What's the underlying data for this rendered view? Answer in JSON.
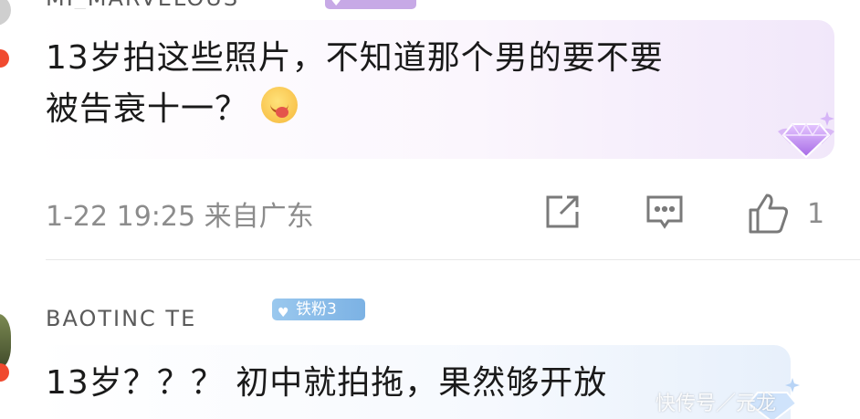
{
  "comments": [
    {
      "username": "MI_MARVELOUS",
      "fan_badge": "",
      "text_line1": "13岁拍这些照片，不知道那个男的要不要",
      "text_line2": "被告衰十一？",
      "emoji": "drooling-face-emoji",
      "timestamp": "1-22 19:25",
      "location": "来自广东",
      "like_count": "1"
    },
    {
      "username": "BAOTINC TE",
      "fan_badge": "铁粉3",
      "text_line1": "13岁？？？ 初中就拍拖，果然够开放"
    }
  ],
  "icons": {
    "share": "share-icon",
    "reply": "comment-icon",
    "like": "thumbs-up-icon",
    "fan_badge": "heart-icon",
    "vip": "diamond-icon"
  },
  "colors": {
    "fan_badge_blue": "#8bbce9",
    "fan_badge_purple": "#c7a9e6",
    "avatar_badge": "#f04a2f",
    "meta_text": "#8c8c8c"
  },
  "watermark": "快传号／元龙"
}
